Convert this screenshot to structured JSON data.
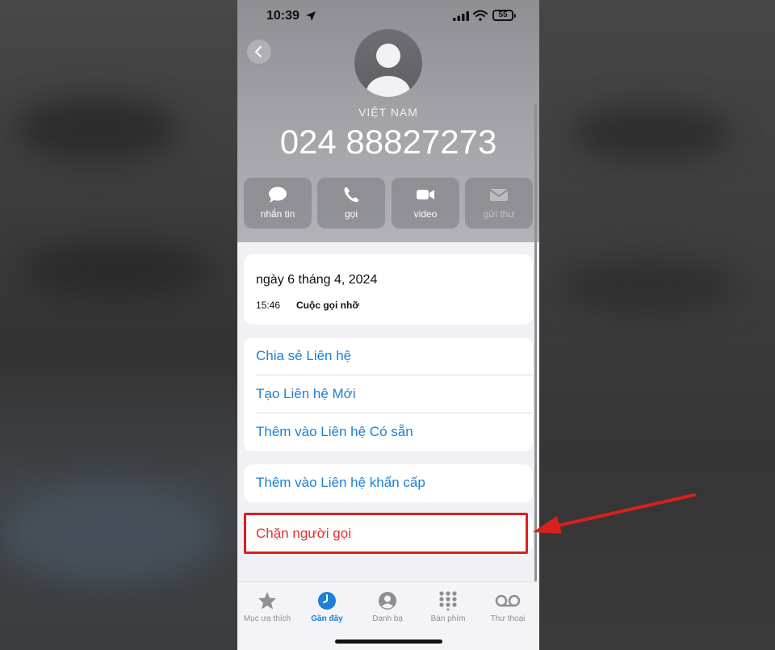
{
  "status_bar": {
    "time": "10:39",
    "battery": "55"
  },
  "contact": {
    "country": "VIỆT NAM",
    "number": "024 88827273"
  },
  "actions": [
    {
      "label": "nhắn tin",
      "icon": "message-icon",
      "enabled": true
    },
    {
      "label": "gọi",
      "icon": "phone-icon",
      "enabled": true
    },
    {
      "label": "video",
      "icon": "video-icon",
      "enabled": true
    },
    {
      "label": "gửi thư",
      "icon": "mail-icon",
      "enabled": false
    }
  ],
  "call_log": {
    "date": "ngày 6 tháng 4, 2024",
    "time": "15:46",
    "type": "Cuộc gọi nhỡ"
  },
  "menu": {
    "share": "Chia sẻ Liên hệ",
    "create": "Tạo Liên hệ Mới",
    "add_existing": "Thêm vào Liên hệ Có sẵn",
    "emergency": "Thêm vào Liên hệ khẩn cấp",
    "block": "Chặn người gọi"
  },
  "tabs": [
    {
      "label": "Mục ưa thích",
      "icon": "star-icon",
      "active": false
    },
    {
      "label": "Gần đây",
      "icon": "clock-icon",
      "active": true
    },
    {
      "label": "Danh bạ",
      "icon": "person-icon",
      "active": false
    },
    {
      "label": "Bàn phím",
      "icon": "keypad-icon",
      "active": false
    },
    {
      "label": "Thư thoại",
      "icon": "voicemail-icon",
      "active": false
    }
  ],
  "colors": {
    "link": "#1d7fd6",
    "destructive": "#e0302a",
    "annotation": "#d8201c"
  }
}
